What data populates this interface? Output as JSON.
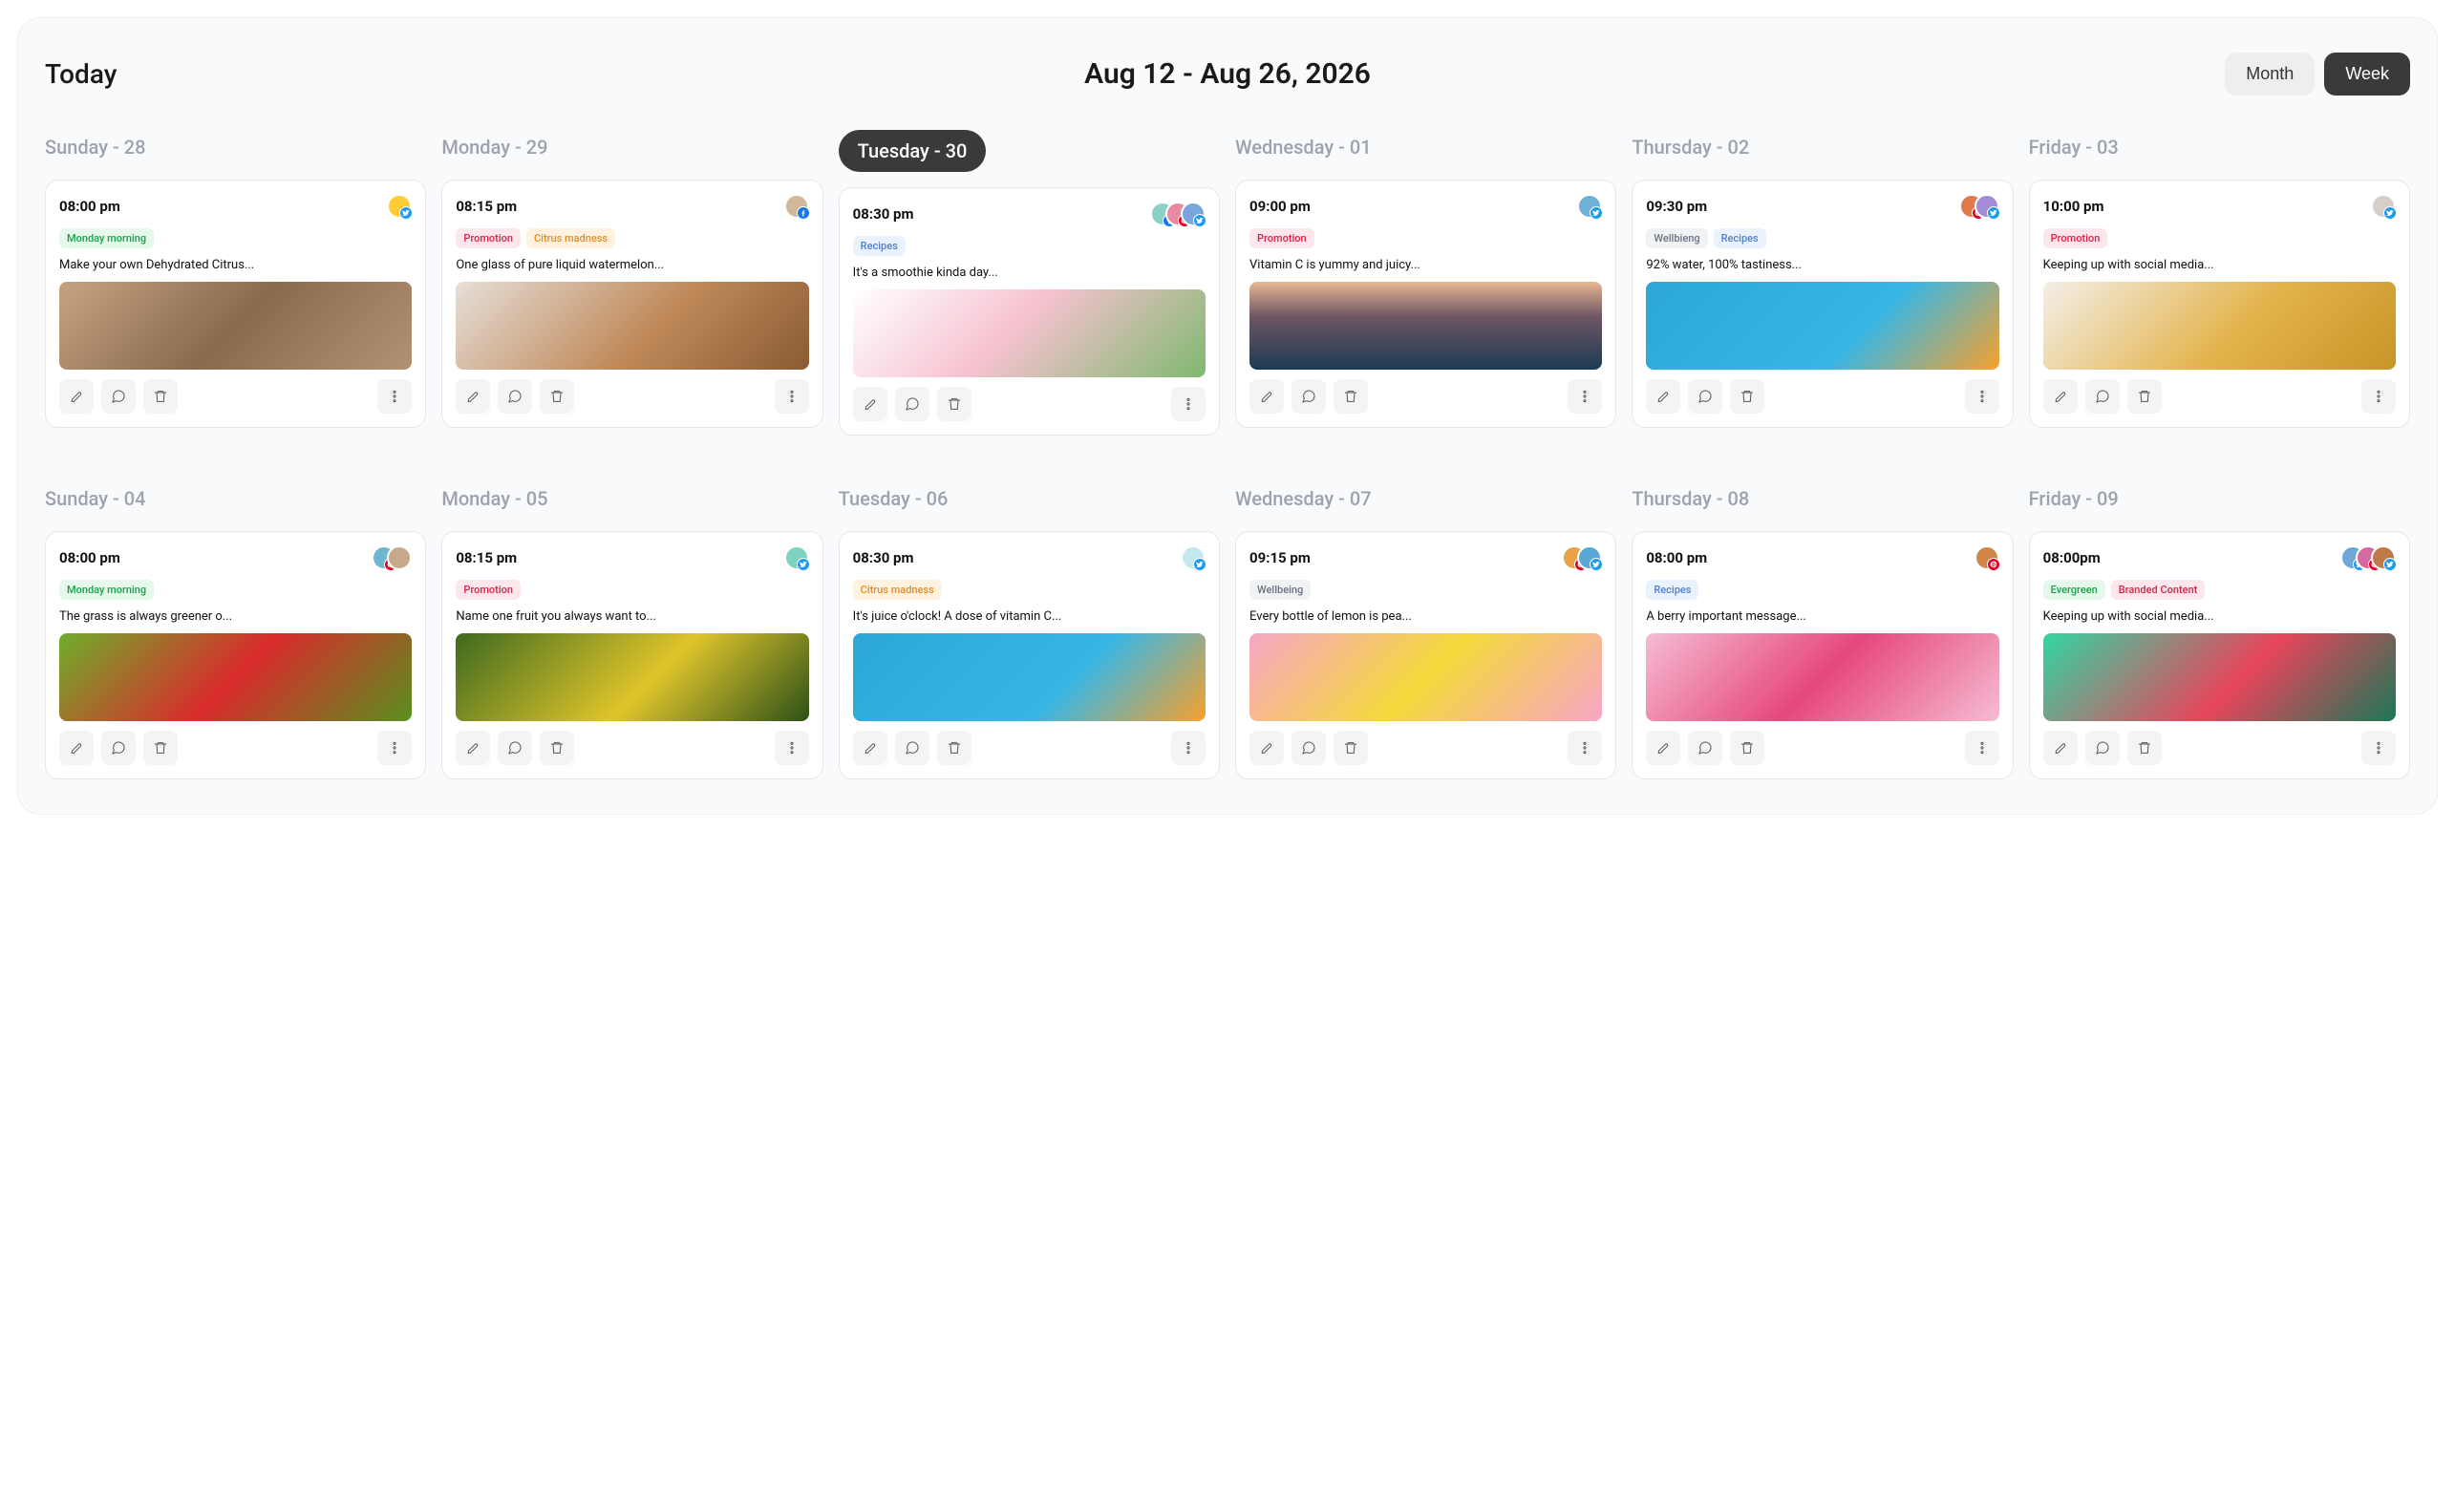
{
  "header": {
    "today_label": "Today",
    "date_range": "Aug 12 - Aug 26, 2026",
    "month_label": "Month",
    "week_label": "Week",
    "active_view": "Week"
  },
  "tag_colors": {
    "Monday morning": {
      "bg": "#e6f7ec",
      "fg": "#16a34a"
    },
    "Promotion": {
      "bg": "#fde7ec",
      "fg": "#e11d48"
    },
    "Citrus madness": {
      "bg": "#fff3e0",
      "fg": "#ea8a1f"
    },
    "Recipes": {
      "bg": "#eaf2fd",
      "fg": "#4f7fce"
    },
    "Wellbieng": {
      "bg": "#f1f2f4",
      "fg": "#6b7280"
    },
    "Wellbeing": {
      "bg": "#f1f2f4",
      "fg": "#6b7280"
    },
    "Evergreen": {
      "bg": "#e6f7ec",
      "fg": "#16a34a"
    },
    "Branded Content": {
      "bg": "#fde7ec",
      "fg": "#e11d48"
    }
  },
  "thumbs": {
    "dogs": "linear-gradient(135deg,#c6a382 0%,#8a6a4d 50%,#b39274 100%)",
    "cat": "linear-gradient(135deg,#e6dfd8 0%,#c08a5a 55%,#8a5a32 100%)",
    "tulips": "linear-gradient(135deg,#ffffff 0%,#f6c2d0 45%,#7fb96f 100%)",
    "mountain": "linear-gradient(180deg,#e8b892 0%,#6d5563 40%,#1d3b52 100%)",
    "orange": "linear-gradient(135deg,#2aa7d8 0%,#37b6e6 60%,#f7a12d 100%)",
    "livingroom": "linear-gradient(135deg,#f4efe9 0%,#e3b44c 55%,#c79427 100%)",
    "apples": "linear-gradient(135deg,#6fae2b 0%,#d92b2b 50%,#5a8f1f 100%)",
    "grapes": "linear-gradient(135deg,#3e6a1f 0%,#e0c52a 55%,#2c5115 100%)",
    "orange2": "linear-gradient(135deg,#2aa7d8 0%,#37b6e6 60%,#f7a12d 100%)",
    "lemons": "linear-gradient(135deg,#f7a6c6 0%,#f4d93a 50%,#f7a6c6 100%)",
    "berries": "linear-gradient(135deg,#f5bcd4 0%,#e6487b 50%,#f5bcd4 100%)",
    "watermelon": "linear-gradient(135deg,#31d6a3 0%,#e8455b 55%,#1a7856 100%)"
  },
  "weeks": [
    {
      "days": [
        {
          "label": "Sunday - 28",
          "active": false,
          "card": {
            "time": "08:00 pm",
            "avatars": [
              {
                "bg": "#ffcc33",
                "net": "tw"
              }
            ],
            "tags": [
              "Monday morning"
            ],
            "caption": "Make your own Dehydrated Citrus...",
            "thumb": "dogs"
          }
        },
        {
          "label": "Monday - 29",
          "active": false,
          "card": {
            "time": "08:15 pm",
            "avatars": [
              {
                "bg": "#d1b89a",
                "net": "fb"
              }
            ],
            "tags": [
              "Promotion",
              "Citrus madness"
            ],
            "caption": "One glass of pure liquid watermelon...",
            "thumb": "cat"
          }
        },
        {
          "label": "Tuesday - 30",
          "active": true,
          "card": {
            "time": "08:30 pm",
            "avatars": [
              {
                "bg": "#8ad2c8",
                "net": "fb"
              },
              {
                "bg": "#e98aa4",
                "net": "pn"
              },
              {
                "bg": "#7aa6e0",
                "net": "tw"
              }
            ],
            "tags": [
              "Recipes"
            ],
            "caption": "It's a smoothie kinda day...",
            "thumb": "tulips"
          }
        },
        {
          "label": "Wednesday - 01",
          "active": false,
          "card": {
            "time": "09:00 pm",
            "avatars": [
              {
                "bg": "#6fb1d6",
                "net": "tw"
              }
            ],
            "tags": [
              "Promotion"
            ],
            "caption": "Vitamin C is yummy and juicy...",
            "thumb": "mountain"
          }
        },
        {
          "label": "Thursday - 02",
          "active": false,
          "card": {
            "time": "09:30 pm",
            "avatars": [
              {
                "bg": "#e07a4a",
                "net": "pn"
              },
              {
                "bg": "#a48bd6",
                "net": "tw"
              }
            ],
            "tags": [
              "Wellbieng",
              "Recipes"
            ],
            "caption": "92% water, 100% tastiness...",
            "thumb": "orange"
          }
        },
        {
          "label": "Friday - 03",
          "active": false,
          "card": {
            "time": "10:00 pm",
            "avatars": [
              {
                "bg": "#d5cfc7",
                "net": "tw"
              }
            ],
            "tags": [
              "Promotion"
            ],
            "caption": "Keeping up with social media...",
            "thumb": "livingroom"
          }
        }
      ]
    },
    {
      "days": [
        {
          "label": "Sunday - 04",
          "active": false,
          "card": {
            "time": "08:00 pm",
            "avatars": [
              {
                "bg": "#6fb6d1",
                "net": "pn"
              },
              {
                "bg": "#c7a98a",
                "net": ""
              }
            ],
            "tags": [
              "Monday morning"
            ],
            "caption": "The grass is always greener o...",
            "thumb": "apples"
          }
        },
        {
          "label": "Monday - 05",
          "active": false,
          "card": {
            "time": "08:15 pm",
            "avatars": [
              {
                "bg": "#7dd3c0",
                "net": "tw"
              }
            ],
            "tags": [
              "Promotion"
            ],
            "caption": "Name one fruit you always want to...",
            "thumb": "grapes"
          }
        },
        {
          "label": "Tuesday - 06",
          "active": false,
          "card": {
            "time": "08:30 pm",
            "avatars": [
              {
                "bg": "#c3e8ef",
                "net": "tw"
              }
            ],
            "tags": [
              "Citrus madness"
            ],
            "caption": "It's juice o'clock! A dose of vitamin C...",
            "thumb": "orange2"
          }
        },
        {
          "label": "Wednesday - 07",
          "active": false,
          "card": {
            "time": "09:15 pm",
            "avatars": [
              {
                "bg": "#e8a24a",
                "net": "pn"
              },
              {
                "bg": "#5aa7d6",
                "net": "tw"
              }
            ],
            "tags": [
              "Wellbeing"
            ],
            "caption": "Every bottle of lemon is pea...",
            "thumb": "lemons"
          }
        },
        {
          "label": "Thursday - 08",
          "active": false,
          "card": {
            "time": "08:00 pm",
            "avatars": [
              {
                "bg": "#d1874a",
                "net": "pn"
              }
            ],
            "tags": [
              "Recipes"
            ],
            "caption": "A berry important message...",
            "thumb": "berries"
          }
        },
        {
          "label": "Friday - 09",
          "active": false,
          "card": {
            "time": "08:00pm",
            "avatars": [
              {
                "bg": "#6fa8d6",
                "net": "tw"
              },
              {
                "bg": "#d46aa0",
                "net": "pn"
              },
              {
                "bg": "#c07a4a",
                "net": "tw"
              }
            ],
            "tags": [
              "Evergreen",
              "Branded Content"
            ],
            "caption": "Keeping up with social media...",
            "thumb": "watermelon"
          }
        }
      ]
    }
  ]
}
